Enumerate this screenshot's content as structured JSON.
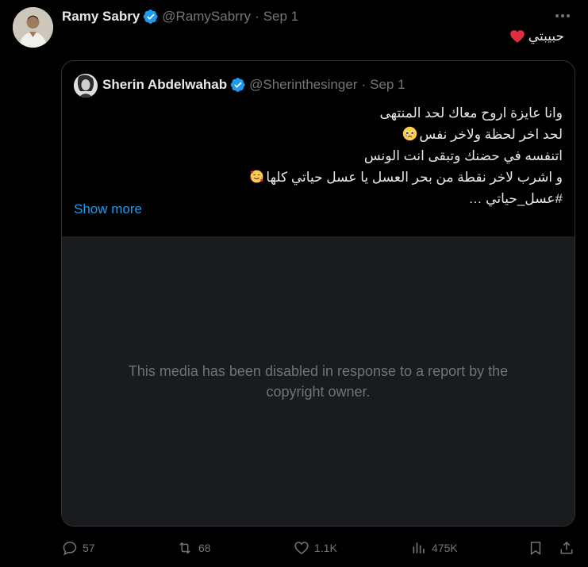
{
  "tweet": {
    "author_name": "Ramy Sabry",
    "handle": "@RamySabrry",
    "separator": "·",
    "date": "Sep 1",
    "more_icon": "more-dots-icon",
    "text": "حبيبتي",
    "text_emoji": "red-heart-icon"
  },
  "quoted": {
    "author_name": "Sherin Abdelwahab",
    "handle": "@Sherinthesinger",
    "separator": "·",
    "date": "Sep 1",
    "lines": [
      "وانا عايزة اروح معاك لحد المنتهى",
      "لحد اخر لحظة ولاخر نفس",
      "اتنفسه في حضنك وتبقى انت الونس",
      "و اشرب لاخر نقطة من بحر العسل يا عسل حياتي كلها",
      "#عسل_حياتي …"
    ],
    "show_more": "Show more",
    "media_message": "This media has been disabled in response to a report by the copyright owner."
  },
  "actions": {
    "replies": "57",
    "reposts": "68",
    "likes": "1.1K",
    "views": "475K"
  },
  "colors": {
    "background": "#000000",
    "text": "#e7e9ea",
    "muted": "#71767b",
    "accent": "#1d9bf0",
    "border": "#2f3336",
    "media_bg": "#1a1b1f"
  }
}
